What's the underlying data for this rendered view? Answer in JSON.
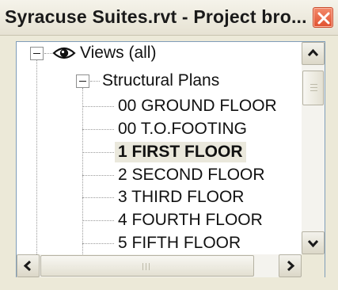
{
  "window": {
    "title": "Syracuse Suites.rvt - Project bro..."
  },
  "tree": {
    "root": {
      "label": "Views (all)",
      "icon": "eye-icon"
    },
    "category": {
      "label": "Structural Plans"
    },
    "items": [
      {
        "label": "00 GROUND FLOOR",
        "selected": false
      },
      {
        "label": "00 T.O.FOOTING",
        "selected": false
      },
      {
        "label": "1 FIRST FLOOR",
        "selected": true
      },
      {
        "label": "2 SECOND FLOOR",
        "selected": false
      },
      {
        "label": "3 THIRD FLOOR",
        "selected": false
      },
      {
        "label": "4 FOURTH FLOOR",
        "selected": false
      },
      {
        "label": "5 FIFTH FLOOR",
        "selected": false
      }
    ]
  },
  "colors": {
    "close_button": "#e0502e",
    "selected_background": "#eae8dc",
    "tree_border": "#7f9db9"
  }
}
